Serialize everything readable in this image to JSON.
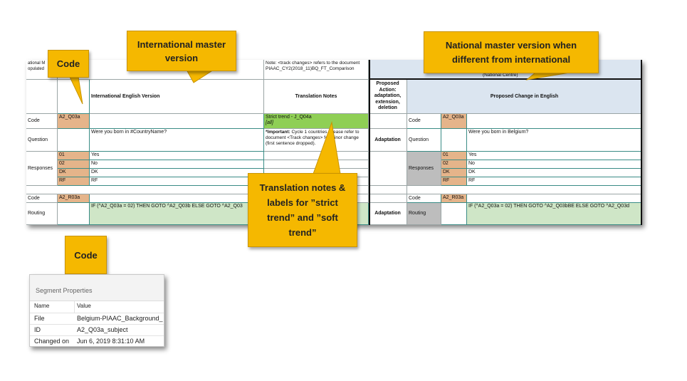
{
  "callouts": {
    "code_top": "Code",
    "international": "International master version",
    "national": "National master version when different from international",
    "translation": "Translation notes & labels for ”strict trend” and ”soft trend”",
    "code_bottom": "Code"
  },
  "sheet": {
    "left_header_partial": "ational M\nopulated",
    "note_text": "Note: <track changes> refers to the document PIAAC_CY2(2018_11)BQ_FT_Comparison",
    "national_centre": "(National Centre)",
    "col_international": "International English Version",
    "col_translation_notes": "Translation Notes",
    "col_proposed_action": "Proposed Action: adaptation, extension, deletion",
    "col_proposed_change": "Proposed Change in English",
    "labels": {
      "code": "Code",
      "question": "Question",
      "responses": "Responses",
      "routing": "Routing"
    },
    "q_code": "A2_Q03a",
    "q_text_international": "Were you born in #CountryName?",
    "q_text_national": "Were you born in Belgium?",
    "trend_label": "Strict trend - J_Q04a",
    "trend_all": "[all]",
    "note_important_bold": "*Important:",
    "note_important_text": " Cycle 1 countries, please refer to document <Track changes> for minor change (first sentence dropped).",
    "responses": [
      {
        "code": "01",
        "label": "Yes"
      },
      {
        "code": "02",
        "label": "No"
      },
      {
        "code": "DK",
        "label": "DK"
      },
      {
        "code": "RF",
        "label": "RF"
      }
    ],
    "r_code": "A2_R03a",
    "routing_international": "IF (^A2_Q03a = 02) THEN GOTO ^A2_Q03b ELSE GOTO ^A2_Q03",
    "routing_national": "IF (^A2_Q03a = 02) THEN GOTO ^A2_Q03bBE ELSE GOTO ^A2_Q03d",
    "action_adaptation": "Adaptation"
  },
  "panel": {
    "title": "Segment Properties",
    "col_name": "Name",
    "col_value": "Value",
    "rows": [
      {
        "name": "File",
        "value": "Belgium-PIAAC_Background_"
      },
      {
        "name": "ID",
        "value": "A2_Q03a_subject"
      },
      {
        "name": "Changed on",
        "value": "Jun 6, 2019 8:31:10 AM"
      }
    ]
  },
  "colors": {
    "callout": "#f5b800",
    "header_blue": "#dbe5f0",
    "code_tan": "#e5b48a",
    "routing_green": "#cfe6c7",
    "trend_green": "#8fcf55",
    "label_grey": "#bdbdbd"
  }
}
